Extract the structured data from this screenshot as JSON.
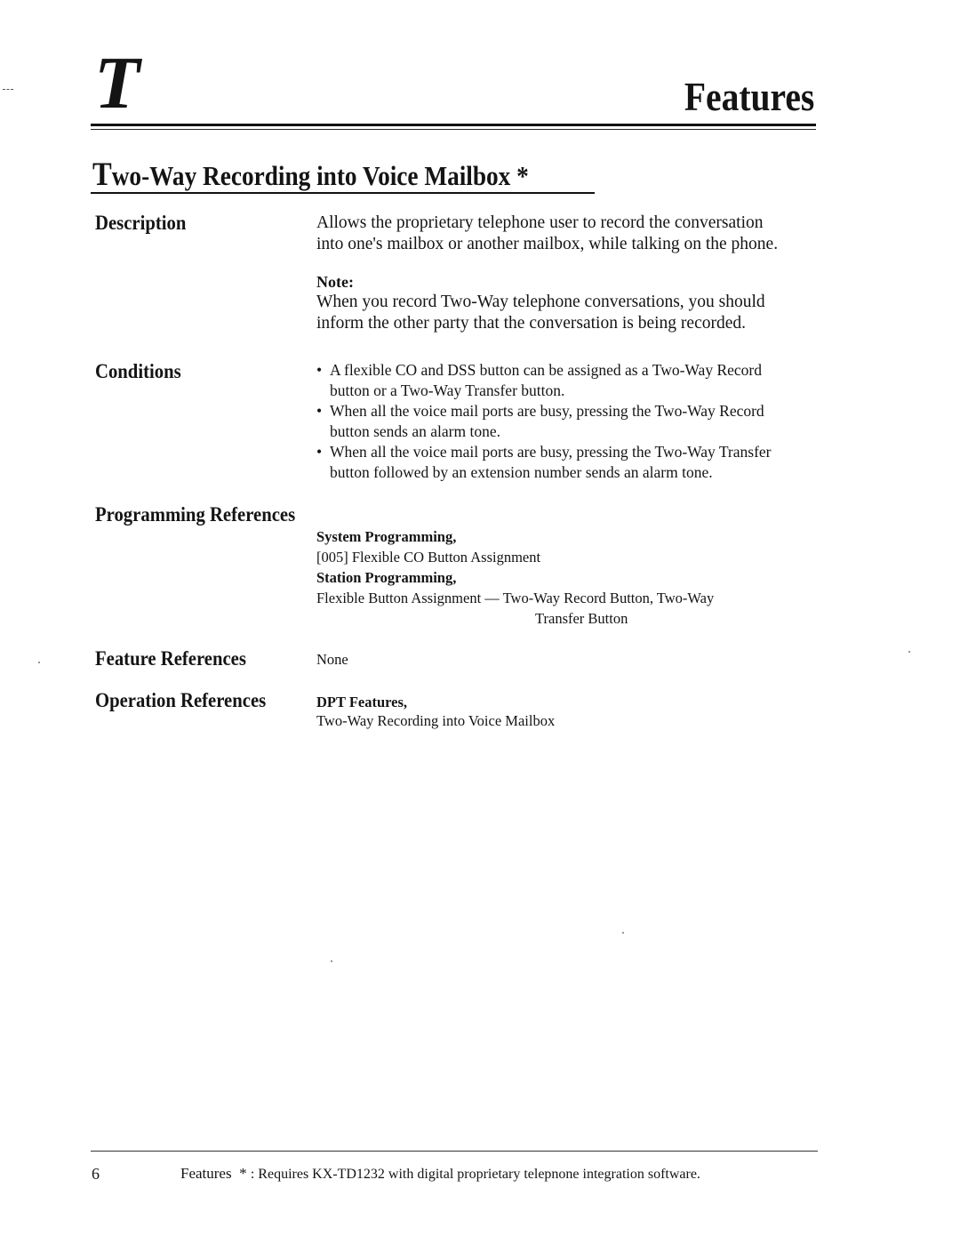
{
  "header": {
    "section_letter": "T",
    "title": "Features"
  },
  "section": {
    "title_cap": "T",
    "title_rest": "wo-Way Recording into Voice Mailbox",
    "asterisk": "*"
  },
  "description": {
    "label": "Description",
    "lines": [
      "Allows the proprietary telephone user to record the conversation",
      "into one's mailbox or another mailbox, while talking on the phone."
    ],
    "note_label": "Note:",
    "note_lines": [
      "When you record Two-Way telephone conversations,  you should",
      "inform the other party that the conversation is being recorded."
    ]
  },
  "conditions": {
    "label": "Conditions",
    "bullet": "•",
    "items": [
      {
        "lines": [
          "A flexible CO and DSS button can be assigned as a Two-Way Record",
          "button or a Two-Way Transfer button."
        ]
      },
      {
        "lines": [
          "When all the voice mail ports are busy, pressing the Two-Way Record",
          "button sends an alarm tone."
        ]
      },
      {
        "lines": [
          "When all the voice mail ports are busy, pressing the Two-Way Transfer",
          "button followed by an extension number sends an alarm tone."
        ]
      }
    ]
  },
  "programming_references": {
    "label": "Programming References",
    "system_heading": "System Programming,",
    "system_item": "[005]  Flexible CO Button Assignment",
    "station_heading": "Station Programming,",
    "station_item_line1": "Flexible Button Assignment — Two-Way Record Button, Two-Way",
    "station_item_line2": "Transfer Button"
  },
  "feature_references": {
    "label": "Feature References",
    "value": "None"
  },
  "operation_references": {
    "label": "Operation References",
    "heading": "DPT Features,",
    "item": "Two-Way Recording into Voice Mailbox"
  },
  "footer": {
    "page_number": "6",
    "section_name": "Features",
    "asterisk": "*",
    "note": ": Requires KX-TD1232 with digital proprietary telepnone integration software."
  }
}
